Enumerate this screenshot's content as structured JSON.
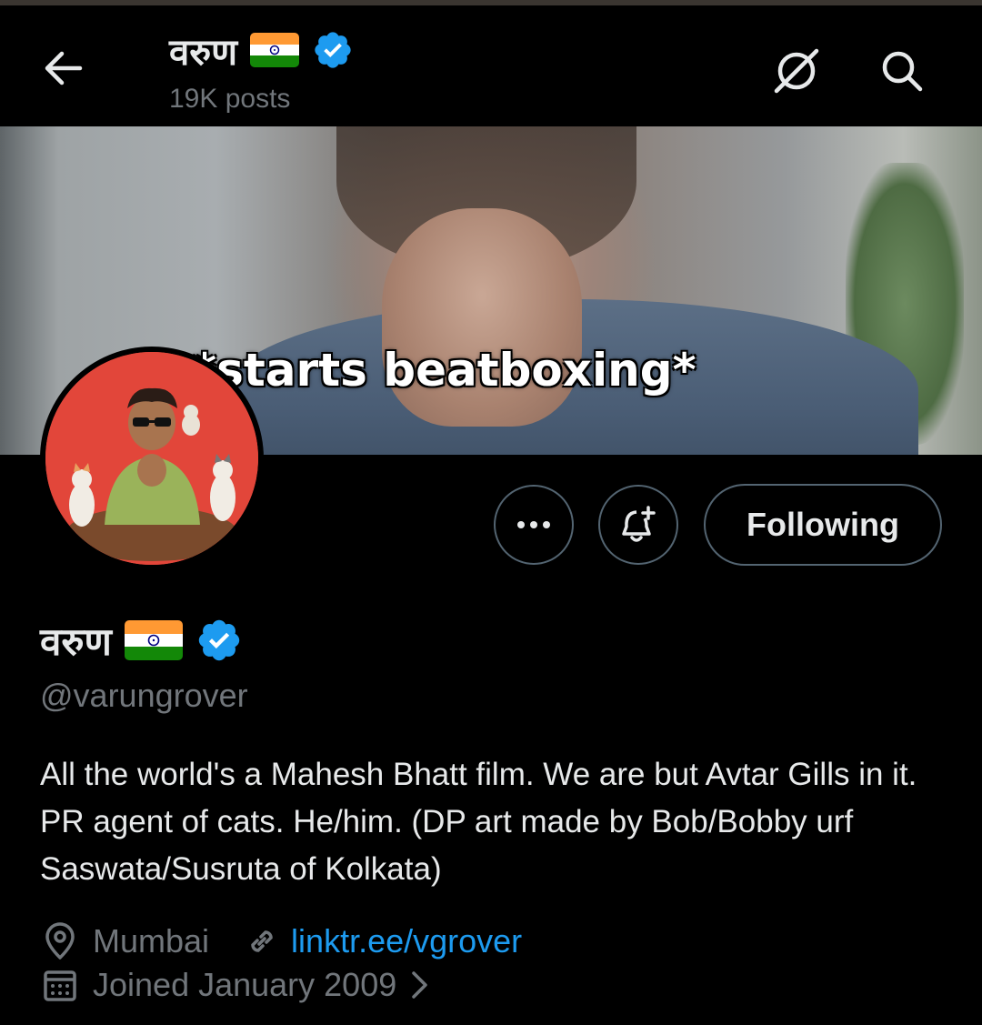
{
  "header": {
    "title": "वरुण",
    "posts_count": "19K posts"
  },
  "banner": {
    "caption": "*starts beatboxing*"
  },
  "actions": {
    "follow_label": "Following"
  },
  "profile": {
    "name": "वरुण",
    "handle": "@varungrover",
    "bio": "All the world's a Mahesh Bhatt film. We are but Avtar Gills in it. PR agent of cats. He/him. (DP art made by Bob/Bobby urf Saswata/Susruta of Kolkata)",
    "location": "Mumbai",
    "website": "linktr.ee/vgrover",
    "joined": "Joined January 2009"
  },
  "colors": {
    "accent": "#1d9bf0",
    "secondary_text": "#71767b",
    "avatar_bg": "#e2463a"
  },
  "icons": [
    "back-arrow-icon",
    "grok-icon",
    "search-icon",
    "more-icon",
    "notification-bell-icon",
    "verified-badge-icon",
    "location-icon",
    "link-icon",
    "calendar-icon",
    "chevron-right-icon",
    "india-flag-icon"
  ]
}
